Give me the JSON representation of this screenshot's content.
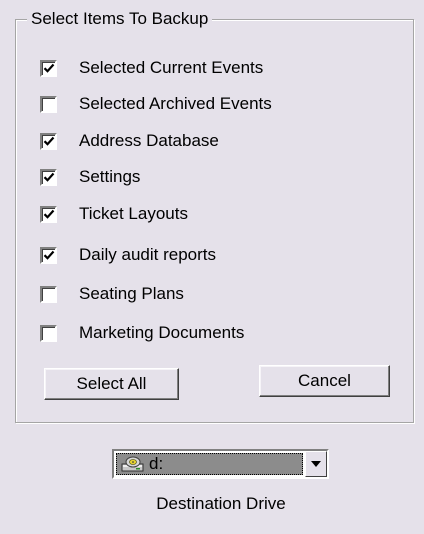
{
  "group": {
    "title": "Select Items To Backup"
  },
  "items": [
    {
      "label": "Selected Current Events",
      "checked": true
    },
    {
      "label": "Selected Archived Events",
      "checked": false
    },
    {
      "label": "Address Database",
      "checked": true
    },
    {
      "label": "Settings",
      "checked": true
    },
    {
      "label": "Ticket Layouts",
      "checked": true
    },
    {
      "label": "Daily audit reports",
      "checked": true
    },
    {
      "label": "Seating Plans",
      "checked": false
    },
    {
      "label": "Marketing Documents",
      "checked": false
    }
  ],
  "buttons": {
    "select_all": "Select All",
    "cancel": "Cancel"
  },
  "drive": {
    "selected": "d:",
    "icon": "disk-drive-icon",
    "caption": "Destination Drive"
  }
}
